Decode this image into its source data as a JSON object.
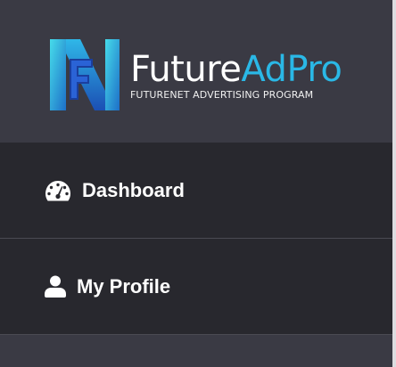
{
  "brand": {
    "name_part1": "Future",
    "name_part2": "AdPro",
    "tagline": "FUTURENET ADVERTISING PROGRAM",
    "logo_icon": "futurenet-logo-icon",
    "colors": {
      "accent": "#2ab8e6",
      "logo_light": "#3fd3e9",
      "logo_dark": "#1e5ec4"
    }
  },
  "menu": {
    "items": [
      {
        "label": "Dashboard",
        "icon": "dashboard-gauge-icon"
      },
      {
        "label": "My Profile",
        "icon": "user-icon"
      }
    ]
  },
  "theme": {
    "sidebar_bg": "#3a3a44",
    "item_bg": "#28282e",
    "divider": "#4a4a52",
    "text": "#ffffff"
  }
}
